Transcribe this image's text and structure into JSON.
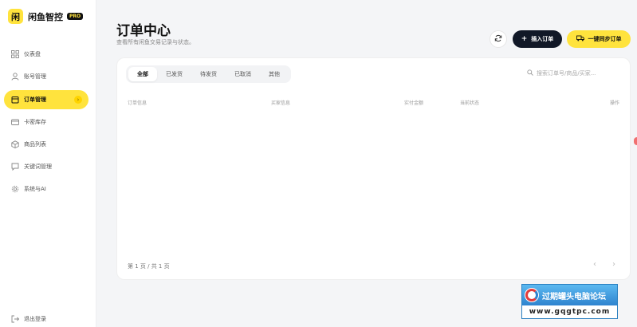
{
  "brand": {
    "logo_char": "闲",
    "name": "闲鱼智控",
    "badge": "PRO"
  },
  "sidebar": {
    "items": [
      {
        "label": "仪表盘",
        "icon": "dashboard-icon",
        "active": false
      },
      {
        "label": "账号管理",
        "icon": "user-icon",
        "active": false
      },
      {
        "label": "订单管理",
        "icon": "order-icon",
        "active": true
      },
      {
        "label": "卡密库存",
        "icon": "card-icon",
        "active": false
      },
      {
        "label": "商品列表",
        "icon": "box-icon",
        "active": false
      },
      {
        "label": "关键词管理",
        "icon": "chat-icon",
        "active": false
      },
      {
        "label": "系统与AI",
        "icon": "gear-icon",
        "active": false
      }
    ],
    "logout_label": "退出登录"
  },
  "header": {
    "title": "订单中心",
    "subtitle": "查看所有闲鱼交易记录与状态。",
    "insert_label": "插入订单",
    "sync_label": "一键同步订单"
  },
  "tabs": [
    {
      "label": "全部",
      "active": true
    },
    {
      "label": "已发货",
      "active": false
    },
    {
      "label": "待发货",
      "active": false
    },
    {
      "label": "已取消",
      "active": false
    },
    {
      "label": "其他",
      "active": false
    }
  ],
  "search": {
    "placeholder": "搜索订单号/商品/买家..."
  },
  "table": {
    "columns": [
      "订单信息",
      "买家信息",
      "实付金额",
      "当前状态",
      "操作"
    ],
    "rows": []
  },
  "pagination": {
    "text": "第 1 页 / 共 1 页"
  },
  "watermark": {
    "title": "过期罐头电脑论坛",
    "url": "www.gqgtpc.com"
  },
  "colors": {
    "accent": "#ffe33d",
    "dark_button": "#111827"
  }
}
